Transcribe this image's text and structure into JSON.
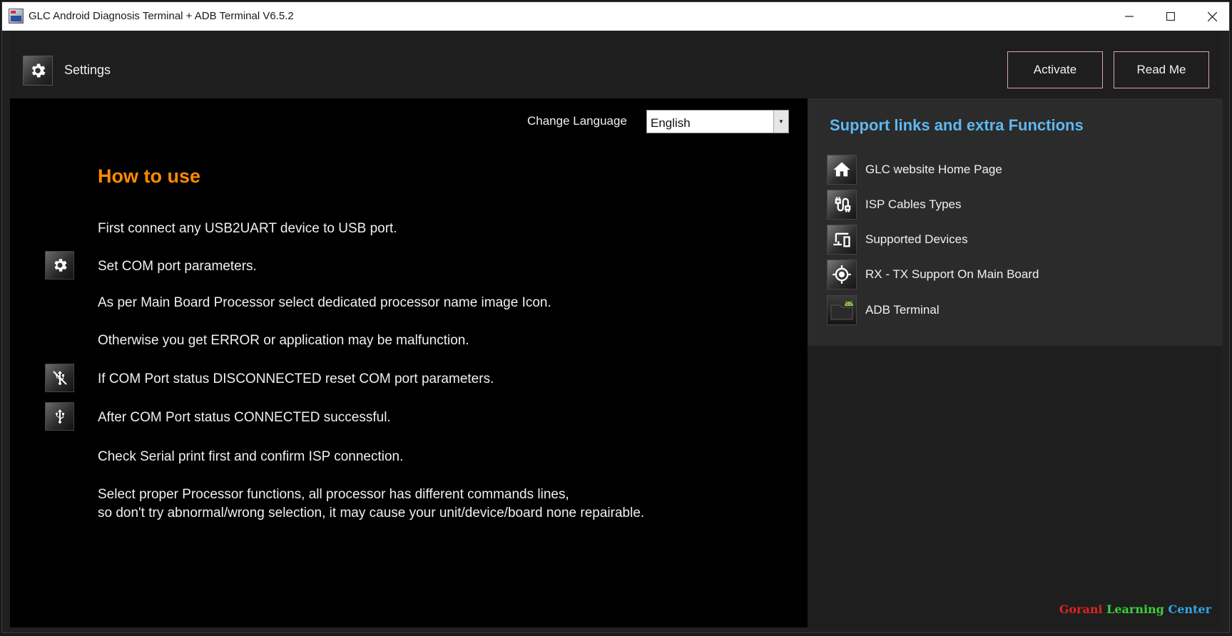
{
  "window": {
    "title": "GLC Android Diagnosis Terminal + ADB Terminal V6.5.2"
  },
  "header": {
    "settings_label": "Settings",
    "activate_label": "Activate",
    "readme_label": "Read Me"
  },
  "language": {
    "label": "Change Language",
    "selected": "English"
  },
  "how_to": {
    "title": "How to use",
    "steps": [
      "First connect any USB2UART device to USB port.",
      "Set COM port parameters.",
      "As per Main Board Processor select dedicated processor name image Icon.",
      "Otherwise you get ERROR or application may be malfunction.",
      "If COM Port status DISCONNECTED reset COM port parameters.",
      "After COM Port status CONNECTED successful.",
      "Check Serial print first and confirm ISP connection.",
      "Select proper Processor functions, all processor has different commands lines,",
      "so don't try abnormal/wrong selection, it may cause your unit/device/board none repairable."
    ]
  },
  "support": {
    "title": "Support links and extra Functions",
    "items": [
      {
        "label": "GLC website Home Page",
        "icon": "home-icon"
      },
      {
        "label": "ISP Cables Types",
        "icon": "cable-icon"
      },
      {
        "label": "Supported Devices",
        "icon": "devices-icon"
      },
      {
        "label": "RX - TX Support On Main Board",
        "icon": "target-icon"
      },
      {
        "label": "ADB Terminal",
        "icon": "android-folder-icon"
      }
    ]
  },
  "branding": {
    "word1": "Gorani",
    "word2": "Learning",
    "word3": "Center"
  },
  "colors": {
    "accent_orange": "#ff8a00",
    "support_title_blue": "#5eb8f0",
    "brand_red": "#e0241f",
    "brand_green": "#3bd23b",
    "brand_blue": "#2fa8e8"
  }
}
